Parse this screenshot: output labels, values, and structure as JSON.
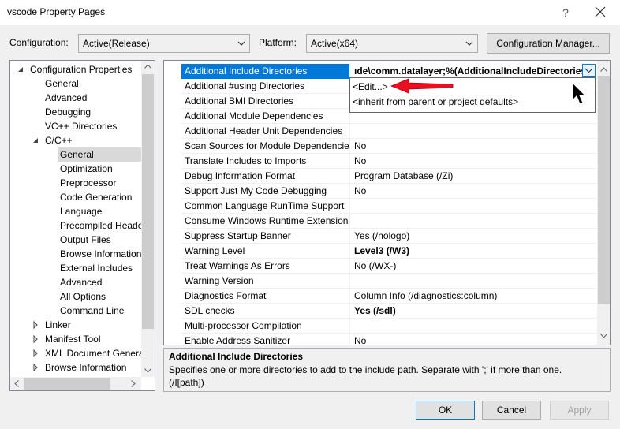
{
  "window": {
    "title": "vscode Property Pages",
    "help_glyph": "?"
  },
  "header": {
    "configuration_label": "Configuration:",
    "configuration_value": "Active(Release)",
    "platform_label": "Platform:",
    "platform_value": "Active(x64)",
    "config_manager_label": "Configuration Manager..."
  },
  "tree": {
    "items": [
      {
        "label": "Configuration Properties",
        "expander": "expanded"
      },
      {
        "label": "General"
      },
      {
        "label": "Advanced"
      },
      {
        "label": "Debugging"
      },
      {
        "label": "VC++ Directories"
      },
      {
        "label": "C/C++",
        "expander": "expanded"
      },
      {
        "label": "General",
        "selected": true
      },
      {
        "label": "Optimization"
      },
      {
        "label": "Preprocessor"
      },
      {
        "label": "Code Generation"
      },
      {
        "label": "Language"
      },
      {
        "label": "Precompiled Heade"
      },
      {
        "label": "Output Files"
      },
      {
        "label": "Browse Information"
      },
      {
        "label": "External Includes"
      },
      {
        "label": "Advanced"
      },
      {
        "label": "All Options"
      },
      {
        "label": "Command Line"
      },
      {
        "label": "Linker",
        "expander": "collapsed"
      },
      {
        "label": "Manifest Tool",
        "expander": "collapsed"
      },
      {
        "label": "XML Document Genera",
        "expander": "collapsed"
      },
      {
        "label": "Browse Information",
        "expander": "collapsed"
      }
    ]
  },
  "grid": {
    "rows": [
      {
        "name": "Additional Include Directories",
        "value": "ıde\\comm.datalayer;%(AdditionalIncludeDirectories)",
        "bold": true,
        "selected": true
      },
      {
        "name": "Additional #using Directories",
        "value": ""
      },
      {
        "name": "Additional BMI Directories",
        "value": ""
      },
      {
        "name": "Additional Module Dependencies",
        "value": ""
      },
      {
        "name": "Additional Header Unit Dependencies",
        "value": ""
      },
      {
        "name": "Scan Sources for Module Dependencies",
        "value": "No"
      },
      {
        "name": "Translate Includes to Imports",
        "value": "No"
      },
      {
        "name": "Debug Information Format",
        "value": "Program Database (/Zi)"
      },
      {
        "name": "Support Just My Code Debugging",
        "value": "No"
      },
      {
        "name": "Common Language RunTime Support",
        "value": ""
      },
      {
        "name": "Consume Windows Runtime Extension",
        "value": ""
      },
      {
        "name": "Suppress Startup Banner",
        "value": "Yes (/nologo)"
      },
      {
        "name": "Warning Level",
        "value": "Level3 (/W3)",
        "bold": true
      },
      {
        "name": "Treat Warnings As Errors",
        "value": "No (/WX-)"
      },
      {
        "name": "Warning Version",
        "value": ""
      },
      {
        "name": "Diagnostics Format",
        "value": "Column Info (/diagnostics:column)"
      },
      {
        "name": "SDL checks",
        "value": "Yes (/sdl)",
        "bold": true
      },
      {
        "name": "Multi-processor Compilation",
        "value": ""
      },
      {
        "name": "Enable Address Sanitizer",
        "value": "No"
      }
    ],
    "dropdown_options": [
      "<Edit...>",
      "<inherit from parent or project defaults>"
    ]
  },
  "description": {
    "title": "Additional Include Directories",
    "text": "Specifies one or more directories to add to the include path. Separate with ';' if more than one.",
    "syntax": "(/I[path])"
  },
  "footer": {
    "ok_label": "OK",
    "cancel_label": "Cancel",
    "apply_label": "Apply"
  },
  "colors": {
    "selection": "#0078d7",
    "annotation_arrow": "#e81123"
  }
}
